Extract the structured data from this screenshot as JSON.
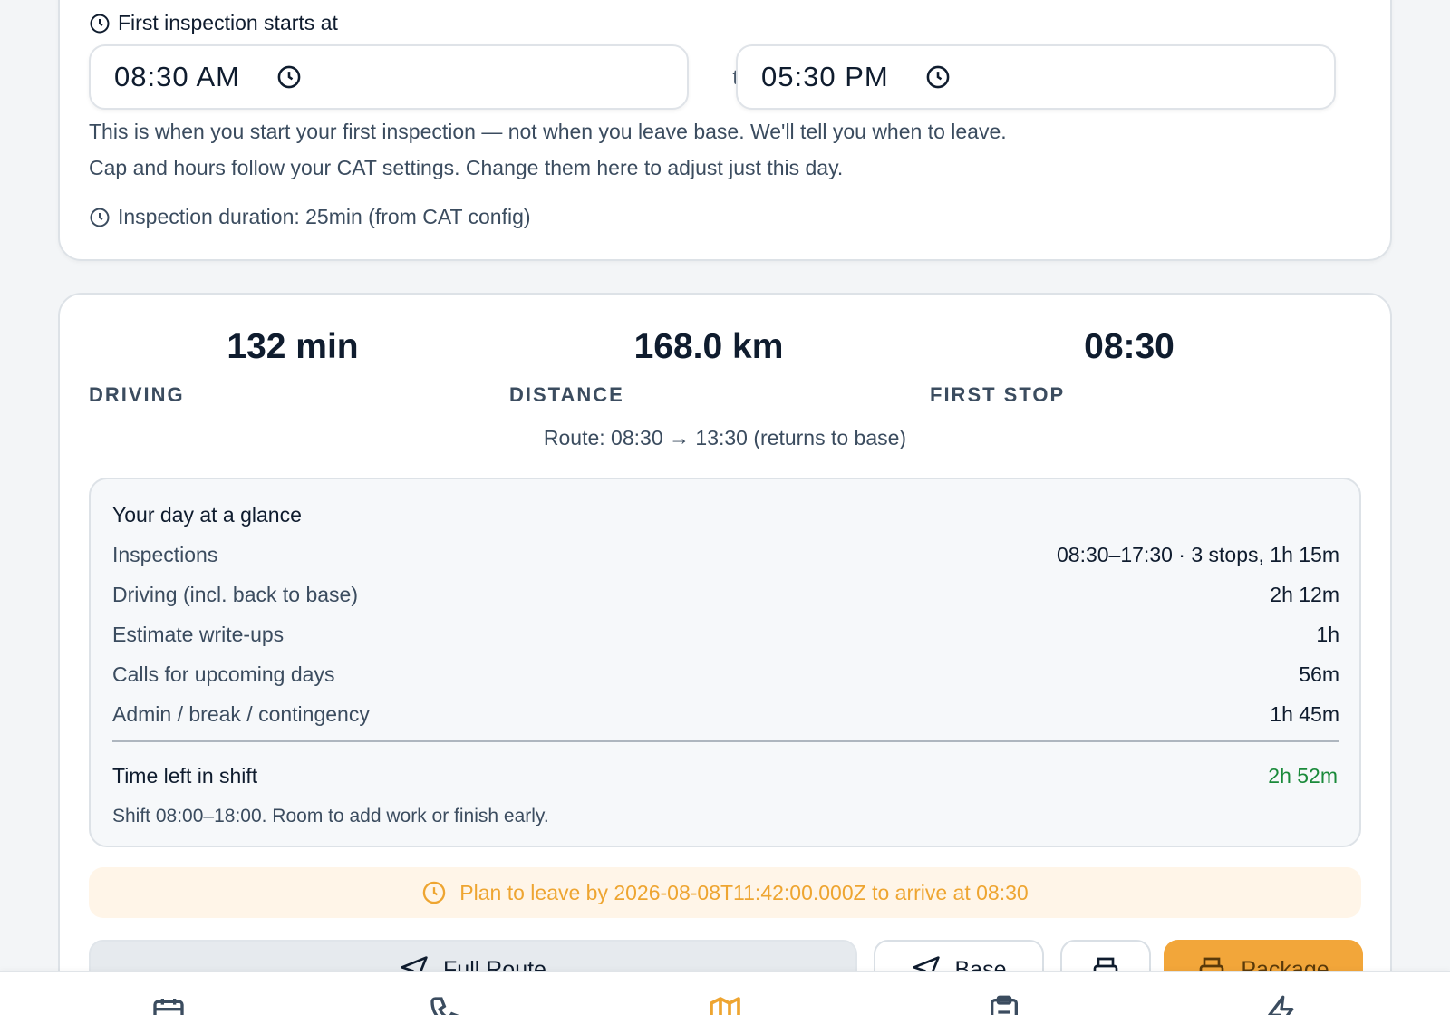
{
  "schedule": {
    "first_inspection_label": "First inspection starts at",
    "start_time": "08:30 AM",
    "end_time": "05:30 PM",
    "to_label": "to",
    "helper_1": "This is when you start your first inspection — not when you leave base. We'll tell you when to leave.",
    "helper_2": "Cap and hours follow your CAT settings. Change them here to adjust just this day.",
    "duration_text": "Inspection duration: 25min (from CAT config)"
  },
  "stats": [
    {
      "value": "132 min",
      "label": "DRIVING"
    },
    {
      "value": "168.0 km",
      "label": "DISTANCE"
    },
    {
      "value": "08:30",
      "label": "FIRST STOP"
    }
  ],
  "route_text": "Route: 08:30 → 13:30 (returns to base)",
  "glance": {
    "title": "Your day at a glance",
    "rows": [
      {
        "key": "Inspections",
        "value": "08:30–17:30 · 3 stops, 1h 15m"
      },
      {
        "key": "Driving (incl. back to base)",
        "value": "2h 12m"
      },
      {
        "key": "Estimate write-ups",
        "value": "1h"
      },
      {
        "key": "Calls for upcoming days",
        "value": "56m"
      },
      {
        "key": "Admin / break / contingency",
        "value": "1h 45m"
      }
    ],
    "time_left_label": "Time left in shift",
    "time_left_value": "2h 52m",
    "note": "Shift 08:00–18:00. Room to add work or finish early."
  },
  "leave_banner": "Plan to leave by 2026-08-08T11:42:00.000Z to arrive at 08:30",
  "buttons": {
    "full_route": "Full Route",
    "base": "Base",
    "package": "Package"
  },
  "colors": {
    "accent": "#f2a63a",
    "success": "#1a8a3a",
    "banner_bg": "#fff5e8",
    "banner_text": "#eea531"
  },
  "nav": {
    "items": [
      "calendar-icon",
      "phone-icon",
      "map-icon",
      "clipboard-icon",
      "lightning-icon"
    ],
    "active": "map-icon"
  }
}
